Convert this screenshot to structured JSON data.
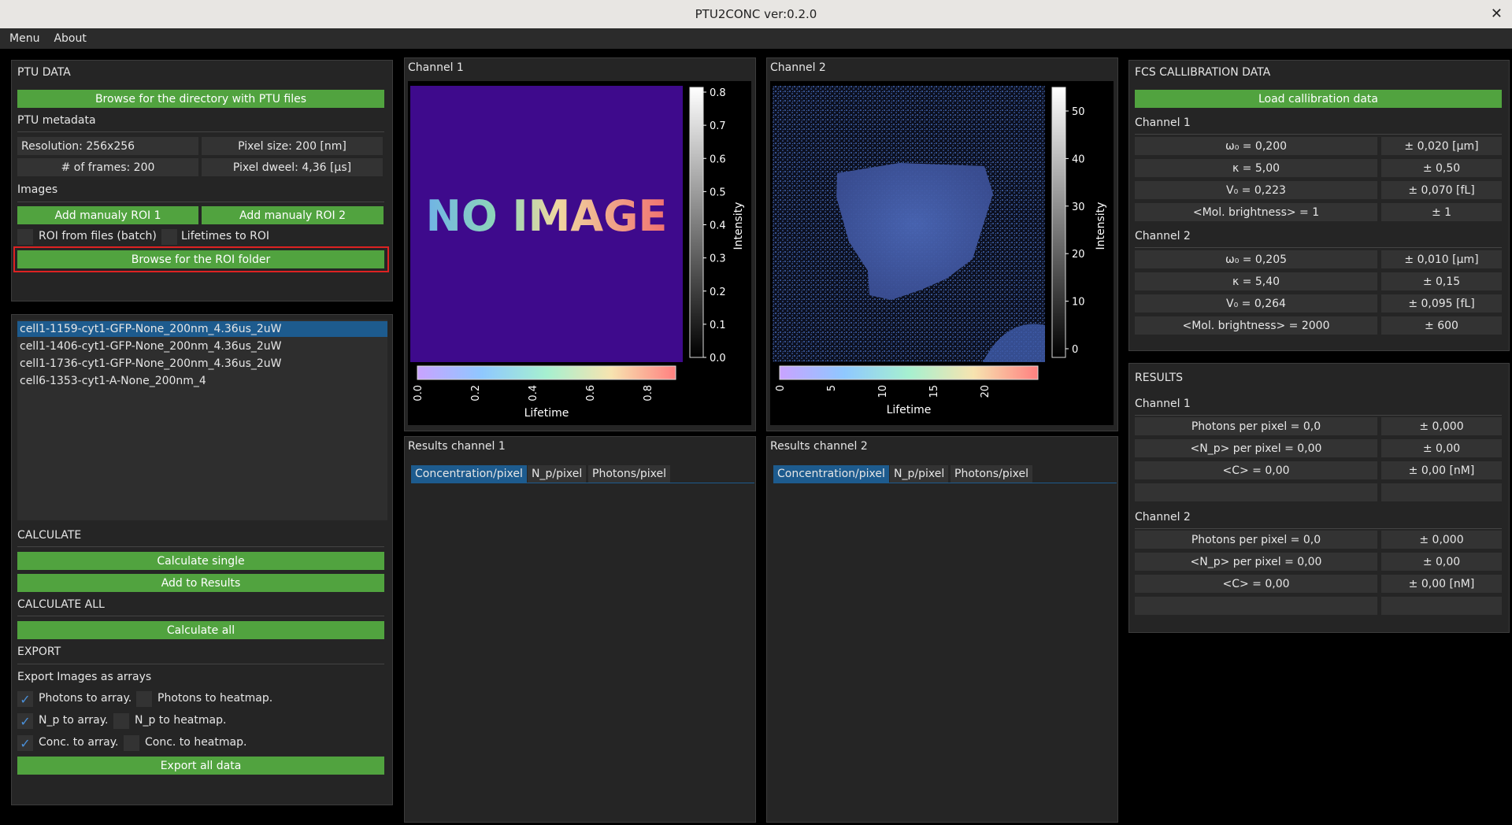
{
  "window": {
    "title": "PTU2CONC  ver:0.2.0",
    "close_glyph": "✕"
  },
  "menubar": {
    "menu": "Menu",
    "about": "About"
  },
  "left": {
    "ptu_data_title": "PTU DATA",
    "browse_ptu": "Browse for the directory with PTU files",
    "metadata_title": "PTU metadata",
    "resolution": "Resolution: 256x256",
    "pixel_size": "Pixel size: 200 [nm]",
    "frames": "# of frames: 200",
    "pixel_dwell": "Pixel dweel: 4,36 [µs]",
    "images_title": "Images",
    "add_roi1": "Add manualy ROI 1",
    "add_roi2": "Add manualy ROI 2",
    "roi_from_files": "ROI from files (batch)",
    "lifetimes_to_roi": "Lifetimes to ROI",
    "browse_roi": "Browse for the ROI folder",
    "files": [
      "cell1-1159-cyt1-GFP-None_200nm_4.36us_2uW",
      "cell1-1406-cyt1-GFP-None_200nm_4.36us_2uW",
      "cell1-1736-cyt1-GFP-None_200nm_4.36us_2uW",
      "cell6-1353-cyt1-A-None_200nm_4"
    ],
    "calculate_title": "CALCULATE",
    "calc_single": "Calculate single",
    "add_results": "Add to Results",
    "calc_all_title": "CALCULATE ALL",
    "calc_all": "Calculate all",
    "export_title": "EXPORT",
    "export_images": "Export Images as arrays",
    "photons_array": "Photons to array.",
    "photons_heatmap": "Photons to heatmap.",
    "np_array": "N_p to array.",
    "np_heatmap": "N_p to heatmap.",
    "conc_array": "Conc. to array.",
    "conc_heatmap": "Conc. to heatmap.",
    "check_glyph": "✓",
    "export_all": "Export all data"
  },
  "channel1": {
    "title": "Channel 1",
    "no_image": "NO IMAGE",
    "intensity_label": "Intensity",
    "intensity_ticks": [
      "0.8",
      "0.7",
      "0.6",
      "0.5",
      "0.4",
      "0.3",
      "0.2",
      "0.1",
      "0.0"
    ],
    "lifetime_label": "Lifetime",
    "lifetime_ticks": [
      "0.0",
      "0.2",
      "0.4",
      "0.6",
      "0.8"
    ]
  },
  "channel2": {
    "title": "Channel 2",
    "intensity_label": "Intensity",
    "intensity_ticks": [
      "50",
      "40",
      "30",
      "20",
      "10",
      "0"
    ],
    "lifetime_label": "Lifetime",
    "lifetime_ticks": [
      "0",
      "5",
      "10",
      "15",
      "20"
    ]
  },
  "results1": {
    "title": "Results channel 1",
    "tabs": [
      "Concentration/pixel",
      "N_p/pixel",
      "Photons/pixel"
    ]
  },
  "results2": {
    "title": "Results channel 2",
    "tabs": [
      "Concentration/pixel",
      "N_p/pixel",
      "Photons/pixel"
    ]
  },
  "fcs": {
    "title": "FCS CALLIBRATION DATA",
    "load": "Load callibration data",
    "ch1_title": "Channel 1",
    "ch1": [
      [
        "ω₀ = 0,200",
        "± 0,020 [µm]"
      ],
      [
        "κ = 5,00",
        "± 0,50"
      ],
      [
        "V₀ = 0,223",
        "± 0,070 [fL]"
      ],
      [
        "<Mol. brightness> = 1",
        "± 1"
      ]
    ],
    "ch2_title": "Channel 2",
    "ch2": [
      [
        "ω₀ = 0,205",
        "± 0,010 [µm]"
      ],
      [
        "κ = 5,40",
        "± 0,15"
      ],
      [
        "V₀ = 0,264",
        "± 0,095 [fL]"
      ],
      [
        "<Mol. brightness> = 2000",
        "± 600"
      ]
    ]
  },
  "results": {
    "title": "RESULTS",
    "ch1_title": "Channel 1",
    "ch1": [
      [
        "Photons per pixel = 0,0",
        "± 0,000"
      ],
      [
        "<N_p> per pixel = 0,00",
        "± 0,00"
      ],
      [
        "<C> = 0,00",
        "± 0,00 [nM]"
      ],
      [
        "",
        ""
      ]
    ],
    "ch2_title": "Channel 2",
    "ch2": [
      [
        "Photons per pixel = 0,0",
        "± 0,000"
      ],
      [
        "<N_p> per pixel = 0,00",
        "± 0,00"
      ],
      [
        "<C> = 0,00",
        "± 0,00 [nM]"
      ],
      [
        "",
        ""
      ]
    ]
  }
}
